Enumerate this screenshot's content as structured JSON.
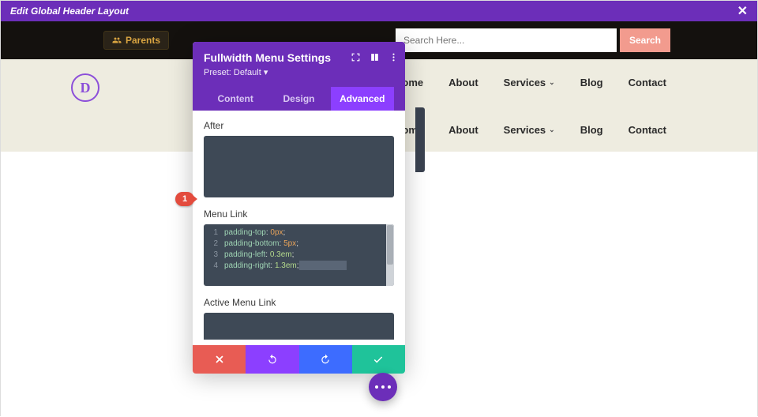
{
  "topbar": {
    "title": "Edit Global Header Layout"
  },
  "header": {
    "parents_label": "Parents",
    "search_placeholder": "Search Here...",
    "search_button": "Search"
  },
  "nav": {
    "home": "Home",
    "about": "About",
    "services": "Services",
    "blog": "Blog",
    "contact": "Contact"
  },
  "logo_letter": "D",
  "panel": {
    "title": "Fullwidth Menu Settings",
    "preset": "Preset: Default ▾",
    "tabs": {
      "content": "Content",
      "design": "Design",
      "advanced": "Advanced"
    },
    "active_tab": "advanced",
    "field_after": "After",
    "field_menu_link": "Menu Link",
    "field_active_menu_link": "Active Menu Link",
    "code": {
      "l1": {
        "n": "1",
        "prop": "padding-top",
        "val": "0px"
      },
      "l2": {
        "n": "2",
        "prop": "padding-bottom",
        "val": "5px"
      },
      "l3": {
        "n": "3",
        "prop": "padding-left",
        "val": "0.3em"
      },
      "l4": {
        "n": "4",
        "prop": "padding-right",
        "val": "1.3em"
      }
    }
  },
  "badge": "1"
}
